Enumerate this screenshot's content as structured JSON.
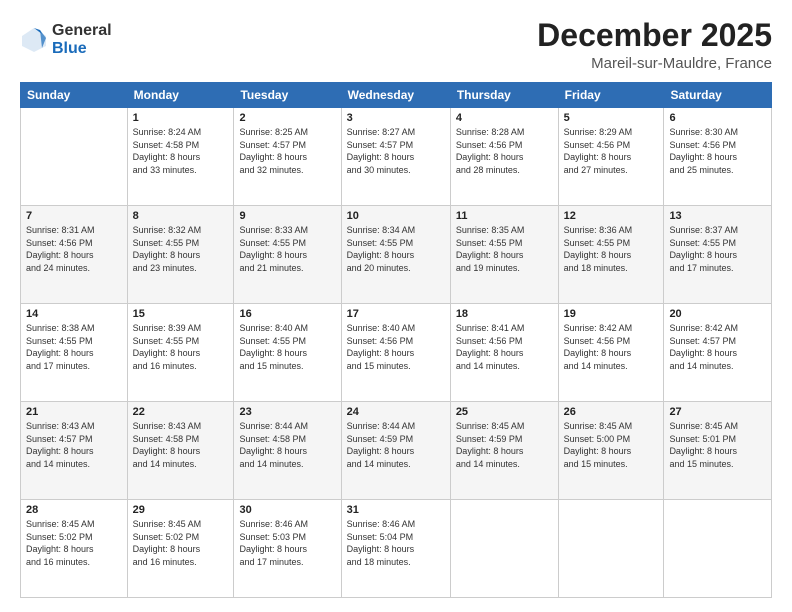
{
  "logo": {
    "general": "General",
    "blue": "Blue"
  },
  "title": "December 2025",
  "location": "Mareil-sur-Mauldre, France",
  "headers": [
    "Sunday",
    "Monday",
    "Tuesday",
    "Wednesday",
    "Thursday",
    "Friday",
    "Saturday"
  ],
  "weeks": [
    [
      {
        "day": "",
        "info": ""
      },
      {
        "day": "1",
        "info": "Sunrise: 8:24 AM\nSunset: 4:58 PM\nDaylight: 8 hours\nand 33 minutes."
      },
      {
        "day": "2",
        "info": "Sunrise: 8:25 AM\nSunset: 4:57 PM\nDaylight: 8 hours\nand 32 minutes."
      },
      {
        "day": "3",
        "info": "Sunrise: 8:27 AM\nSunset: 4:57 PM\nDaylight: 8 hours\nand 30 minutes."
      },
      {
        "day": "4",
        "info": "Sunrise: 8:28 AM\nSunset: 4:56 PM\nDaylight: 8 hours\nand 28 minutes."
      },
      {
        "day": "5",
        "info": "Sunrise: 8:29 AM\nSunset: 4:56 PM\nDaylight: 8 hours\nand 27 minutes."
      },
      {
        "day": "6",
        "info": "Sunrise: 8:30 AM\nSunset: 4:56 PM\nDaylight: 8 hours\nand 25 minutes."
      }
    ],
    [
      {
        "day": "7",
        "info": "Sunrise: 8:31 AM\nSunset: 4:56 PM\nDaylight: 8 hours\nand 24 minutes."
      },
      {
        "day": "8",
        "info": "Sunrise: 8:32 AM\nSunset: 4:55 PM\nDaylight: 8 hours\nand 23 minutes."
      },
      {
        "day": "9",
        "info": "Sunrise: 8:33 AM\nSunset: 4:55 PM\nDaylight: 8 hours\nand 21 minutes."
      },
      {
        "day": "10",
        "info": "Sunrise: 8:34 AM\nSunset: 4:55 PM\nDaylight: 8 hours\nand 20 minutes."
      },
      {
        "day": "11",
        "info": "Sunrise: 8:35 AM\nSunset: 4:55 PM\nDaylight: 8 hours\nand 19 minutes."
      },
      {
        "day": "12",
        "info": "Sunrise: 8:36 AM\nSunset: 4:55 PM\nDaylight: 8 hours\nand 18 minutes."
      },
      {
        "day": "13",
        "info": "Sunrise: 8:37 AM\nSunset: 4:55 PM\nDaylight: 8 hours\nand 17 minutes."
      }
    ],
    [
      {
        "day": "14",
        "info": "Sunrise: 8:38 AM\nSunset: 4:55 PM\nDaylight: 8 hours\nand 17 minutes."
      },
      {
        "day": "15",
        "info": "Sunrise: 8:39 AM\nSunset: 4:55 PM\nDaylight: 8 hours\nand 16 minutes."
      },
      {
        "day": "16",
        "info": "Sunrise: 8:40 AM\nSunset: 4:55 PM\nDaylight: 8 hours\nand 15 minutes."
      },
      {
        "day": "17",
        "info": "Sunrise: 8:40 AM\nSunset: 4:56 PM\nDaylight: 8 hours\nand 15 minutes."
      },
      {
        "day": "18",
        "info": "Sunrise: 8:41 AM\nSunset: 4:56 PM\nDaylight: 8 hours\nand 14 minutes."
      },
      {
        "day": "19",
        "info": "Sunrise: 8:42 AM\nSunset: 4:56 PM\nDaylight: 8 hours\nand 14 minutes."
      },
      {
        "day": "20",
        "info": "Sunrise: 8:42 AM\nSunset: 4:57 PM\nDaylight: 8 hours\nand 14 minutes."
      }
    ],
    [
      {
        "day": "21",
        "info": "Sunrise: 8:43 AM\nSunset: 4:57 PM\nDaylight: 8 hours\nand 14 minutes."
      },
      {
        "day": "22",
        "info": "Sunrise: 8:43 AM\nSunset: 4:58 PM\nDaylight: 8 hours\nand 14 minutes."
      },
      {
        "day": "23",
        "info": "Sunrise: 8:44 AM\nSunset: 4:58 PM\nDaylight: 8 hours\nand 14 minutes."
      },
      {
        "day": "24",
        "info": "Sunrise: 8:44 AM\nSunset: 4:59 PM\nDaylight: 8 hours\nand 14 minutes."
      },
      {
        "day": "25",
        "info": "Sunrise: 8:45 AM\nSunset: 4:59 PM\nDaylight: 8 hours\nand 14 minutes."
      },
      {
        "day": "26",
        "info": "Sunrise: 8:45 AM\nSunset: 5:00 PM\nDaylight: 8 hours\nand 15 minutes."
      },
      {
        "day": "27",
        "info": "Sunrise: 8:45 AM\nSunset: 5:01 PM\nDaylight: 8 hours\nand 15 minutes."
      }
    ],
    [
      {
        "day": "28",
        "info": "Sunrise: 8:45 AM\nSunset: 5:02 PM\nDaylight: 8 hours\nand 16 minutes."
      },
      {
        "day": "29",
        "info": "Sunrise: 8:45 AM\nSunset: 5:02 PM\nDaylight: 8 hours\nand 16 minutes."
      },
      {
        "day": "30",
        "info": "Sunrise: 8:46 AM\nSunset: 5:03 PM\nDaylight: 8 hours\nand 17 minutes."
      },
      {
        "day": "31",
        "info": "Sunrise: 8:46 AM\nSunset: 5:04 PM\nDaylight: 8 hours\nand 18 minutes."
      },
      {
        "day": "",
        "info": ""
      },
      {
        "day": "",
        "info": ""
      },
      {
        "day": "",
        "info": ""
      }
    ]
  ]
}
